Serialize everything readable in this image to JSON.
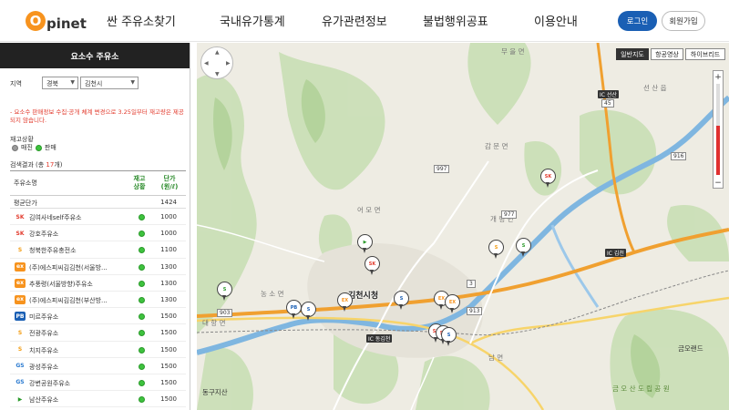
{
  "header": {
    "logo_o": "O",
    "logo_text": "pinet",
    "nav": [
      "싼 주유소찾기",
      "국내유가통계",
      "유가관련정보",
      "불법행위공표",
      "이용안내"
    ],
    "login": "로그인",
    "join": "회원가입"
  },
  "panel": {
    "title": "요소수 주유소",
    "region_label": "지역",
    "province": "경북",
    "city": "김천시",
    "notice": "- 요소수 판매정보 수집·공개 체계 변경으로 3.25일부터 재고량은 제공되지 않습니다.",
    "stock_title": "재고상황",
    "legend_gray": "매진",
    "legend_green": "판매",
    "result_prefix": "검색결과 (총 ",
    "result_count": "17",
    "result_suffix": "개)",
    "col_name": "주유소명",
    "col_status": "재고\n상황",
    "col_price": "단가\n(원/ℓ)",
    "avg_label": "평균단가",
    "avg_value": "1424",
    "rows": [
      {
        "brand": "SK",
        "name": "김여사네self주유소",
        "price": "1000"
      },
      {
        "brand": "SK",
        "name": "강호주유소",
        "price": "1000"
      },
      {
        "brand": "S",
        "name": "청북한주유충전소",
        "price": "1100"
      },
      {
        "brand": "EX",
        "name": "(주)에스피씨김김천(서울방...",
        "price": "1300"
      },
      {
        "brand": "EX",
        "name": "추풍령(서울방향)주유소",
        "price": "1300"
      },
      {
        "brand": "EX",
        "name": "(주)에스피씨김김천(부산방...",
        "price": "1300"
      },
      {
        "brand": "PB",
        "name": "미르주유소",
        "price": "1500"
      },
      {
        "brand": "S",
        "name": "전광주유소",
        "price": "1500"
      },
      {
        "brand": "S",
        "name": "치지주유소",
        "price": "1500"
      },
      {
        "brand": "GS",
        "name": "광성주유소",
        "price": "1500"
      },
      {
        "brand": "GS",
        "name": "강변공원주유소",
        "price": "1500"
      },
      {
        "brand": "HD",
        "name": "남산주유소",
        "price": "1500"
      }
    ]
  },
  "map": {
    "types": [
      "일반지도",
      "항공영상",
      "하이브리드"
    ],
    "labels": {
      "city_hall": "김천시청",
      "gamun": "감 문 면",
      "eomo": "어 모 면",
      "gaeryeong": "개 령 면",
      "nongso": "농 소 면",
      "daehang": "대 항 면",
      "sinsang": "남 면",
      "seonsan": "선 산 읍",
      "mureul": "무 을 면",
      "gumi_land": "금오랜드",
      "gumi_park": "금 오 산 도 립 공 원",
      "station": "동구지산"
    },
    "roads": [
      "997",
      "977",
      "913",
      "903",
      "45",
      "916",
      "3"
    ],
    "ic_labels": [
      "IC 선산",
      "IC 김천",
      "IC 동김천"
    ]
  }
}
